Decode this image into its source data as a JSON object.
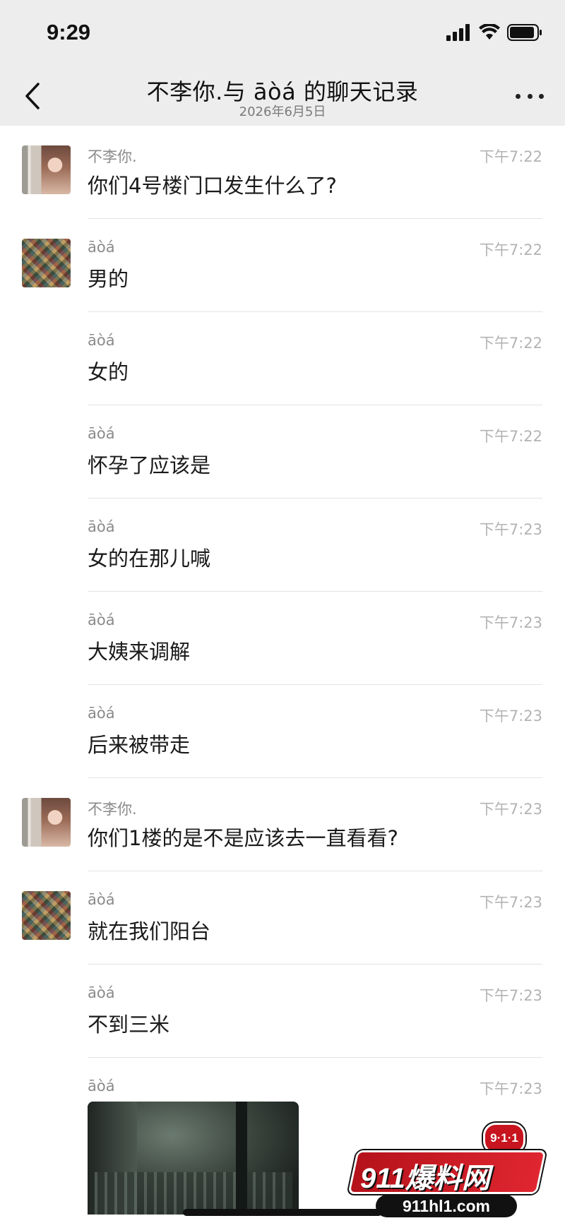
{
  "status": {
    "time": "9:29"
  },
  "nav": {
    "title": "不李你.与 āòá 的聊天记录",
    "subtitle": "2026年6月5日"
  },
  "messages": [
    {
      "sender": "不李你.",
      "time": "下午7:22",
      "text": "你们4号楼门口发生什么了?",
      "avatar": "girl-photo-avatar"
    },
    {
      "sender": "āòá",
      "time": "下午7:22",
      "text": "男的",
      "avatar": "collage-avatar"
    },
    {
      "sender": "āòá",
      "time": "下午7:22",
      "text": "女的"
    },
    {
      "sender": "āòá",
      "time": "下午7:22",
      "text": "怀孕了应该是"
    },
    {
      "sender": "āòá",
      "time": "下午7:23",
      "text": "女的在那儿喊"
    },
    {
      "sender": "āòá",
      "time": "下午7:23",
      "text": "大姨来调解"
    },
    {
      "sender": "āòá",
      "time": "下午7:23",
      "text": "后来被带走"
    },
    {
      "sender": "不李你.",
      "time": "下午7:23",
      "text": "你们1楼的是不是应该去一直看看?",
      "avatar": "girl-photo-avatar"
    },
    {
      "sender": "āòá",
      "time": "下午7:23",
      "text": "就在我们阳台",
      "avatar": "collage-avatar"
    },
    {
      "sender": "āòá",
      "time": "下午7:23",
      "text": "不到三米"
    }
  ],
  "image_message": {
    "sender": "āòá",
    "time": "下午7:23"
  },
  "watermark": {
    "badge": "9·1·1",
    "main": "911爆料网",
    "url": "911hl1.com"
  }
}
